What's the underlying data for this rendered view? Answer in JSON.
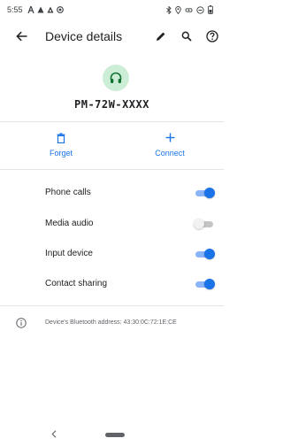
{
  "status_bar": {
    "time": "5:55",
    "left_icons": [
      "notification-a-icon",
      "notification-triangle-icon",
      "notification-triangle-alt-icon",
      "notification-circle-icon"
    ],
    "right_icons": [
      "bluetooth-icon",
      "location-icon",
      "rotation-icon",
      "do-not-disturb-icon",
      "battery-icon"
    ]
  },
  "app_bar": {
    "title": "Device details",
    "back_icon": "arrow-back-icon",
    "actions": [
      "edit-icon",
      "search-icon",
      "help-icon"
    ]
  },
  "device": {
    "name": "PM-72W-XXXX",
    "icon": "headset-icon"
  },
  "actions": {
    "forget_label": "Forget",
    "connect_label": "Connect"
  },
  "profiles": [
    {
      "label": "Phone calls",
      "enabled": true
    },
    {
      "label": "Media audio",
      "enabled": false
    },
    {
      "label": "Input device",
      "enabled": true
    },
    {
      "label": "Contact sharing",
      "enabled": true
    }
  ],
  "info": {
    "bluetooth_address": "Device's Bluetooth address: 43:30:0C:72:1E:CE"
  },
  "colors": {
    "accent": "#1a73e8",
    "avatar_bg": "#cdeed6",
    "avatar_icon": "#137333"
  }
}
